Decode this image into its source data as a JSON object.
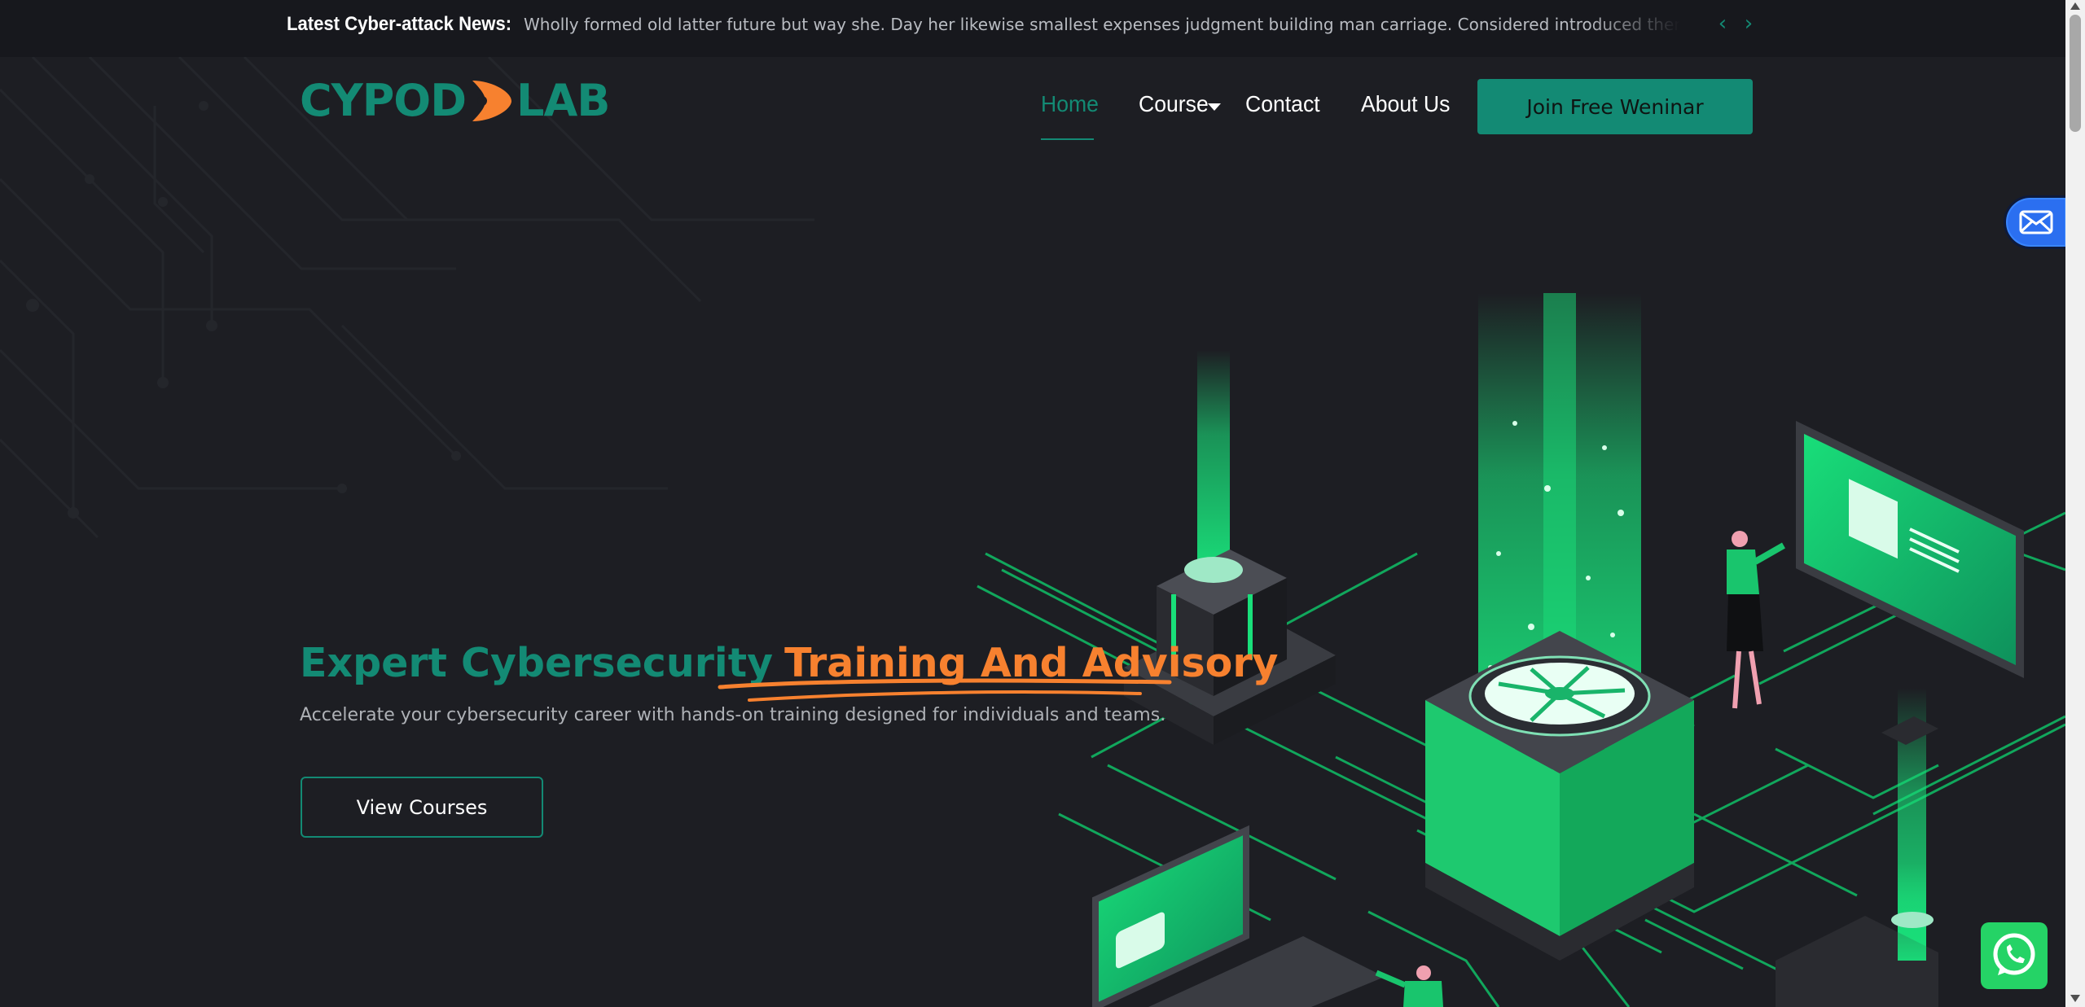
{
  "ticker": {
    "label": "Latest Cyber-attack News:",
    "text": "Wholly formed old latter future but way she. Day her likewise smallest expenses judgment building man carriage. Considered introduced themselves mr to discretion at.",
    "prev_icon": "chevron-left-icon",
    "next_icon": "chevron-right-icon"
  },
  "logo": {
    "part1": "CYPOD",
    "part2": "LAB"
  },
  "nav": {
    "items": [
      {
        "label": "Home",
        "active": true
      },
      {
        "label": "Course",
        "has_dropdown": true
      },
      {
        "label": "Contact"
      },
      {
        "label": "About Us"
      }
    ],
    "cta_label": "Join Free Weninar"
  },
  "hero": {
    "title_part1": "Expert Cybersecurity",
    "title_part2": "Training And Advisory",
    "subtitle": "Accelerate your cybersecurity career with hands-on training designed for individuals and teams.",
    "button_label": "View Courses"
  },
  "colors": {
    "accent": "#138a74",
    "highlight": "#f7812f",
    "background": "#1d1e23",
    "ticker_bg": "#17181d",
    "glow": "#19e07a"
  },
  "floating": {
    "mail_icon": "mail-icon",
    "whatsapp_icon": "whatsapp-icon"
  }
}
